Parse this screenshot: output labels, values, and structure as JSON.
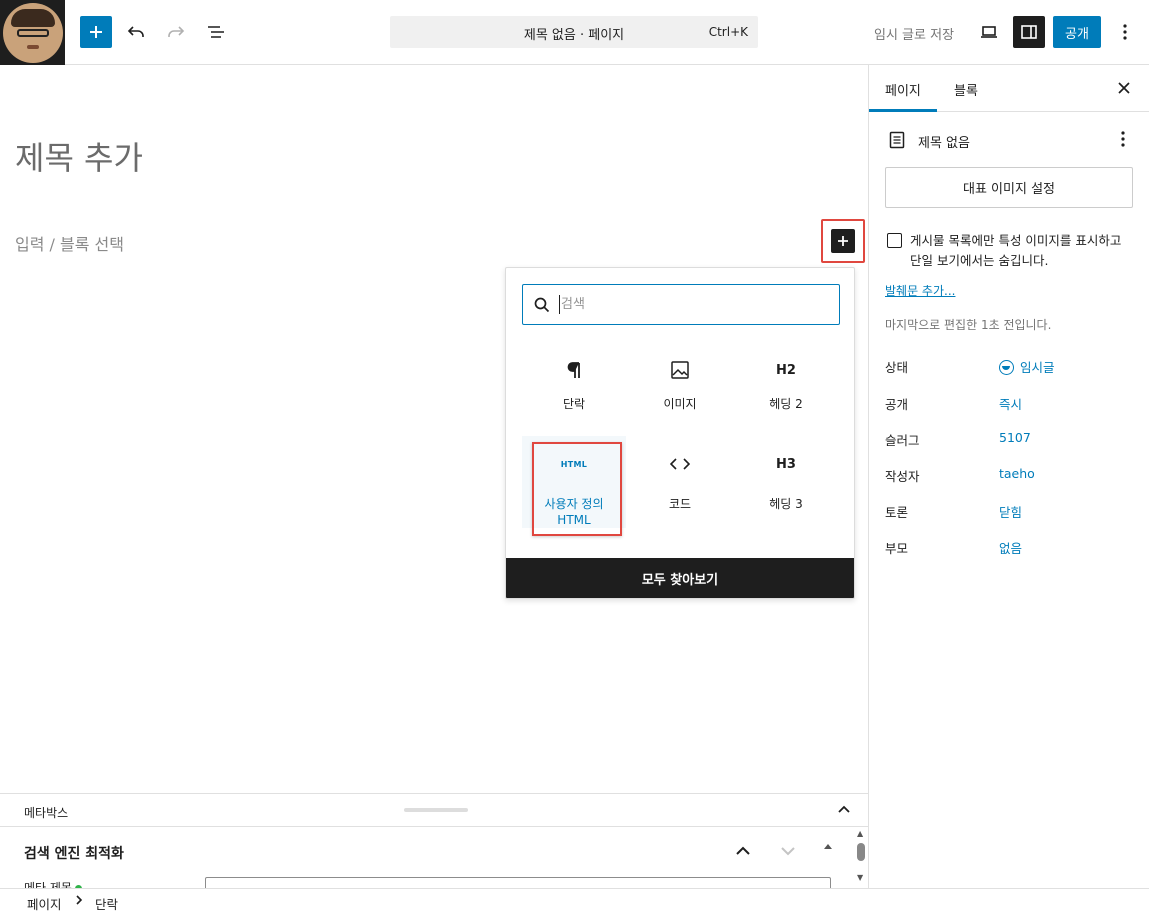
{
  "topbar": {
    "command_title": "제목 없음 · 페이지",
    "command_shortcut": "Ctrl+K",
    "save_draft": "임시 글로 저장",
    "publish": "공개"
  },
  "editor": {
    "title_placeholder": "제목 추가",
    "paragraph_placeholder": "입력 / 블록 선택"
  },
  "inserter": {
    "search_placeholder": "검색",
    "blocks": [
      {
        "label": "단락",
        "icon": "paragraph-icon"
      },
      {
        "label": "이미지",
        "icon": "image-icon"
      },
      {
        "label": "헤딩 2",
        "icon": "H2"
      },
      {
        "label": "사용자 정의 HTML",
        "icon": "HTML"
      },
      {
        "label": "코드",
        "icon": "code-icon"
      },
      {
        "label": "헤딩 3",
        "icon": "H3"
      }
    ],
    "browse_all": "모두 찾아보기"
  },
  "metabox": {
    "title": "메타박스",
    "seo_title": "검색 엔진 최적화",
    "meta_title_label": "메타 제목"
  },
  "sidebar": {
    "tab_page": "페이지",
    "tab_block": "블록",
    "doc_title": "제목 없음",
    "featured_image": "대표 이미지 설정",
    "checkbox_label": "게시물 목록에만 특성 이미지를 표시하고 단일 보기에서는 숨깁니다.",
    "excerpt_link": "발췌문 추가...",
    "last_edited": "마지막으로 편집한 1초 전입니다.",
    "rows": [
      {
        "label": "상태",
        "value": "임시글"
      },
      {
        "label": "공개",
        "value": "즉시"
      },
      {
        "label": "슬러그",
        "value": "5107"
      },
      {
        "label": "작성자",
        "value": "taeho"
      },
      {
        "label": "토론",
        "value": "닫힘"
      },
      {
        "label": "부모",
        "value": "없음"
      }
    ]
  },
  "breadcrumb": [
    "페이지",
    "단락"
  ],
  "colors": {
    "accent": "#007cba",
    "highlight": "#e0473f",
    "dark": "#1e1e1e"
  }
}
